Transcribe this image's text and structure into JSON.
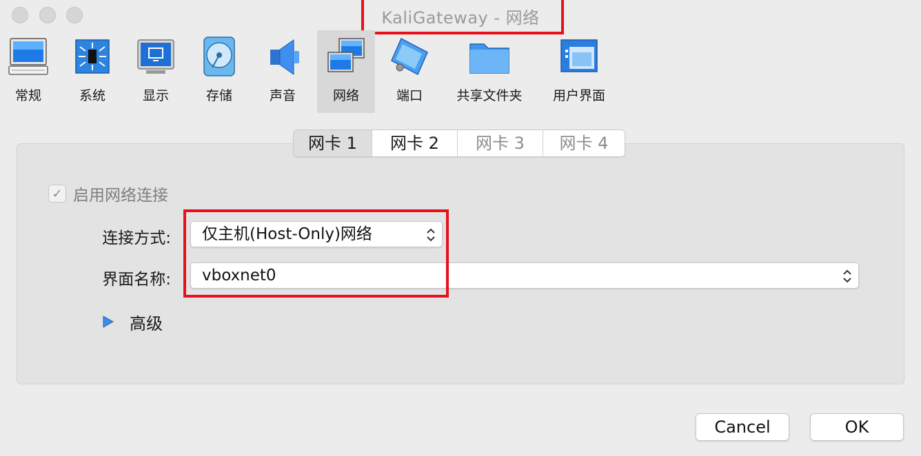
{
  "window": {
    "title": "KaliGateway - 网络"
  },
  "toolbar": {
    "items": [
      {
        "label": "常规",
        "icon": "monitor-icon"
      },
      {
        "label": "系统",
        "icon": "chip-icon"
      },
      {
        "label": "显示",
        "icon": "display-icon"
      },
      {
        "label": "存储",
        "icon": "disk-icon"
      },
      {
        "label": "声音",
        "icon": "speaker-icon"
      },
      {
        "label": "网络",
        "icon": "network-icon"
      },
      {
        "label": "端口",
        "icon": "serial-port-icon"
      },
      {
        "label": "共享文件夹",
        "icon": "folder-icon"
      },
      {
        "label": "用户界面",
        "icon": "ui-window-icon"
      }
    ],
    "active_index": 5
  },
  "adapter_tabs": [
    "网卡 1",
    "网卡 2",
    "网卡 3",
    "网卡 4"
  ],
  "selected_tab_index": 0,
  "enable_network": {
    "label": "启用网络连接",
    "checked": true
  },
  "attached_to": {
    "label": "连接方式:",
    "value": "仅主机(Host-Only)网络"
  },
  "interface_name": {
    "label": "界面名称:",
    "value": "vboxnet0"
  },
  "advanced": {
    "label": "高级"
  },
  "buttons": {
    "cancel": "Cancel",
    "ok": "OK"
  },
  "colors": {
    "annotation_red": "#e8101a",
    "window_bg": "#ececec"
  }
}
